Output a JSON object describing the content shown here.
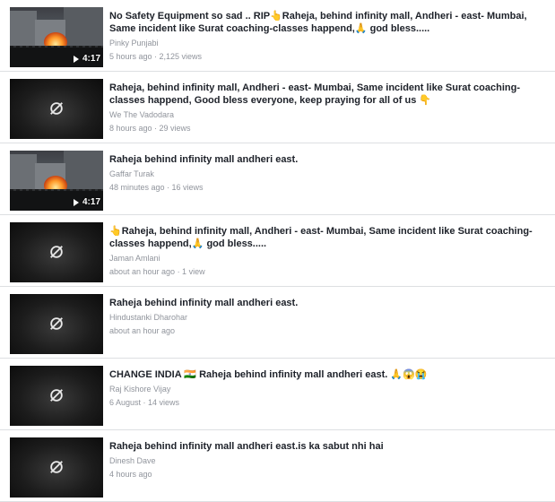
{
  "videos": [
    {
      "title": "No Safety Equipment so sad .. RIP👆Raheja, behind infinity mall, Andheri - east- Mumbai, Same incident like Surat coaching-classes happend,🙏 god bless.....",
      "channel": "Pinky Punjabi",
      "meta": "5 hours ago · 2,125 views",
      "duration": "4:17",
      "thumbnail": "fire-scene",
      "icon": "play-icon"
    },
    {
      "title": "Raheja, behind infinity mall, Andheri - east- Mumbai, Same incident like Surat coaching-classes happend, Good bless everyone, keep praying for all of us 👇",
      "channel": "We The Vadodara",
      "meta": "8 hours ago · 29 views",
      "thumbnail": "hidden",
      "icon": "eye-slash-icon"
    },
    {
      "title": "Raheja behind infinity mall andheri east.",
      "channel": "Gaffar Turak",
      "meta": "48 minutes ago · 16 views",
      "duration": "4:17",
      "thumbnail": "fire-scene",
      "icon": "play-icon"
    },
    {
      "title": "👆Raheja, behind infinity mall, Andheri - east- Mumbai, Same incident like Surat coaching-classes happend,🙏 god bless.....",
      "channel": "Jaman Amlani",
      "meta": "about an hour ago · 1 view",
      "thumbnail": "hidden",
      "icon": "eye-slash-icon"
    },
    {
      "title": "Raheja behind infinity mall andheri east.",
      "channel": "Hindustanki Dharohar",
      "meta": "about an hour ago",
      "thumbnail": "hidden",
      "icon": "eye-slash-icon"
    },
    {
      "title": "CHANGE INDIA 🇮🇳 Raheja behind infinity mall andheri east. 🙏😱😭",
      "channel": "Raj Kishore Vijay",
      "meta": "6 August · 14 views",
      "thumbnail": "hidden",
      "icon": "eye-slash-icon"
    },
    {
      "title": "Raheja behind infinity mall andheri east.is ka sabut nhi hai",
      "channel": "Dinesh Dave",
      "meta": "4 hours ago",
      "thumbnail": "hidden",
      "icon": "eye-slash-icon"
    }
  ],
  "colors": {
    "title": "#1d2129",
    "secondary_text": "#90949c",
    "divider": "#dddfe2"
  }
}
